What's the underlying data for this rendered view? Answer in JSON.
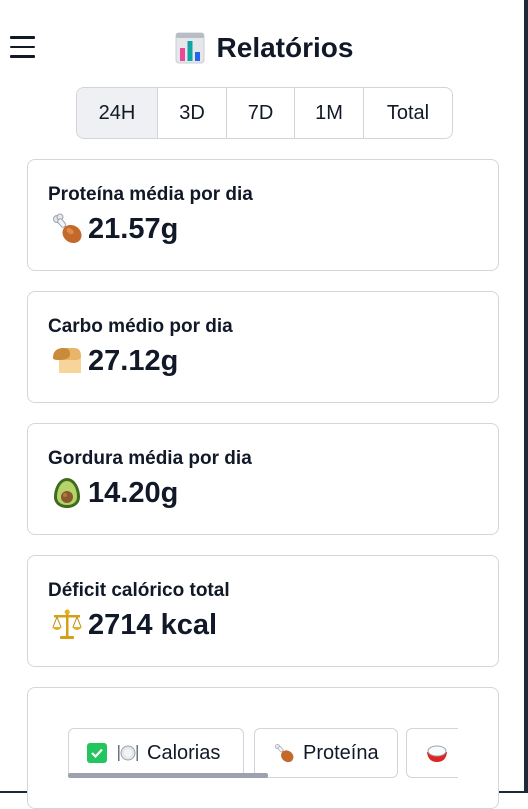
{
  "header": {
    "title": "Relatórios",
    "icon": "bar-chart-icon"
  },
  "range_tabs": [
    {
      "label": "24H",
      "active": true
    },
    {
      "label": "3D",
      "active": false
    },
    {
      "label": "7D",
      "active": false
    },
    {
      "label": "1M",
      "active": false
    },
    {
      "label": "Total",
      "active": false
    }
  ],
  "cards": [
    {
      "label": "Proteína média por dia",
      "value": "21.57g",
      "icon": "poultry-leg-icon"
    },
    {
      "label": "Carbo médio por dia",
      "value": "27.12g",
      "icon": "bread-icon"
    },
    {
      "label": "Gordura média por dia",
      "value": "14.20g",
      "icon": "avocado-icon"
    },
    {
      "label": "Déficit calórico total",
      "value": "2714 kcal",
      "icon": "balance-scale-icon"
    }
  ],
  "chart_filters": [
    {
      "label": "Calorias",
      "checked": true,
      "icon": "plate-icon"
    },
    {
      "label": "Proteína",
      "checked": false,
      "icon": "poultry-leg-icon"
    },
    {
      "label": "",
      "checked": false,
      "icon": "rice-icon"
    }
  ],
  "colors": {
    "checkbox": "#22c55e",
    "border": "#d4d6da",
    "active_tab": "#eef0f3"
  }
}
